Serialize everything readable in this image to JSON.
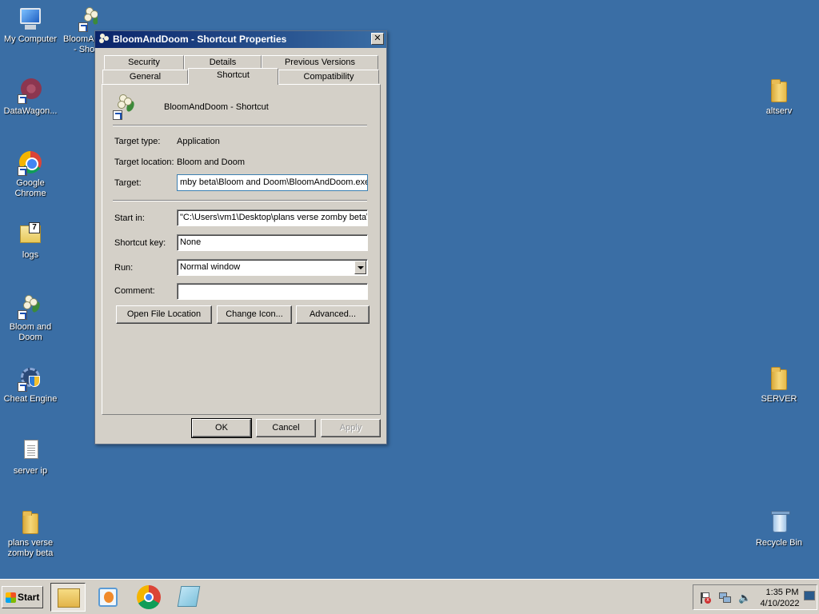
{
  "desktop": {
    "left_icons": [
      {
        "label": "My Computer"
      },
      {
        "label": "DataWagon..."
      },
      {
        "label": "Google Chrome"
      },
      {
        "label": "logs"
      },
      {
        "label": "Bloom and\nDoom"
      },
      {
        "label": "Cheat Engine"
      },
      {
        "label": "server ip"
      },
      {
        "label": "plans verse\nzomby beta"
      }
    ],
    "partial_icon": {
      "label_line1": "BloomAn",
      "label_line2": "- Sho"
    },
    "right_icons": [
      {
        "label": "altserv"
      },
      {
        "label": "SERVER"
      },
      {
        "label": "Recycle Bin"
      }
    ]
  },
  "dialog": {
    "title": "BloomAndDoom - Shortcut Properties",
    "close_glyph": "✕",
    "tabs_row1": [
      "Security",
      "Details",
      "Previous Versions"
    ],
    "tabs_row2": [
      "General",
      "Shortcut",
      "Compatibility"
    ],
    "active_tab": "Shortcut",
    "shortcut_name": "BloomAndDoom - Shortcut",
    "target_type_label": "Target type:",
    "target_type_value": "Application",
    "target_location_label": "Target location:",
    "target_location_value": "Bloom and Doom",
    "target_label": "Target:",
    "target_value": "mby beta\\Bloom and Doom\\BloomAndDoom.exe\"",
    "start_in_label": "Start in:",
    "start_in_value": "\"C:\\Users\\vm1\\Desktop\\plans verse zomby beta\\",
    "shortcut_key_label": "Shortcut key:",
    "shortcut_key_value": "None",
    "run_label": "Run:",
    "run_value": "Normal window",
    "comment_label": "Comment:",
    "comment_value": "",
    "open_file_location": "Open File Location",
    "change_icon": "Change Icon...",
    "advanced": "Advanced...",
    "ok": "OK",
    "cancel": "Cancel",
    "apply": "Apply"
  },
  "taskbar": {
    "start_label": "Start",
    "apps": [
      "file-explorer-icon",
      "media-player-icon",
      "chrome-icon",
      "notepad-icon"
    ],
    "clock_time": "1:35 PM",
    "clock_date": "4/10/2022"
  },
  "colors": {
    "desktop_bg": "#3a6ea5",
    "titlebar_start": "#0a246a",
    "dialog_face": "#d4d0c8"
  }
}
